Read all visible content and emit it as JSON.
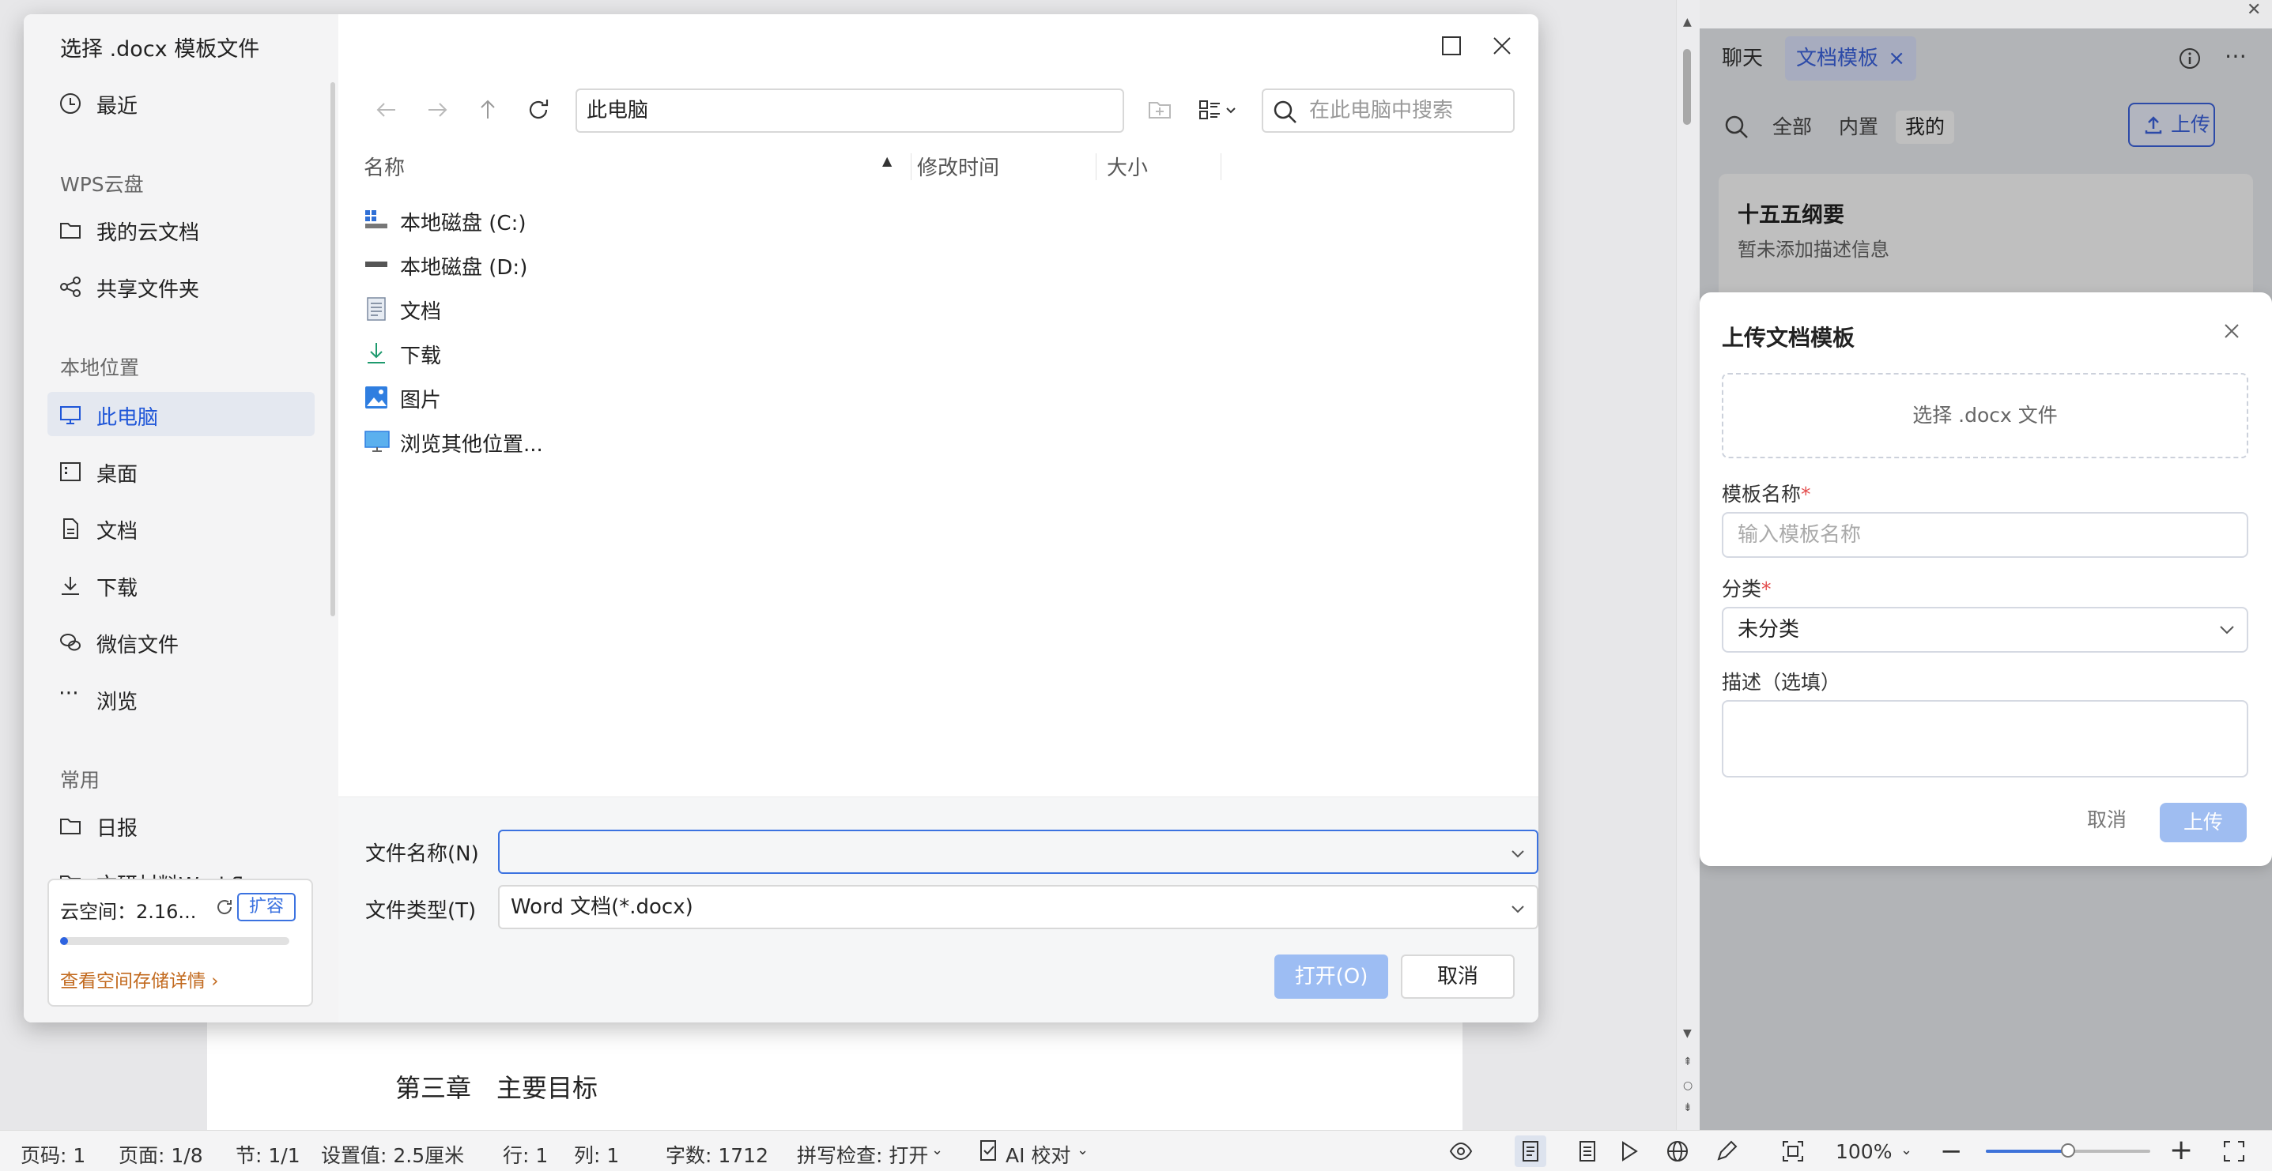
{
  "document": {
    "heading": "第三章　主要目标"
  },
  "file_dialog": {
    "title": "选择 .docx 模板文件",
    "sidebar": {
      "recent": "最近",
      "wps_cloud_section": "WPS云盘",
      "cloud_items": [
        "我的云文档",
        "共享文件夹"
      ],
      "local_section": "本地位置",
      "local_items": [
        "此电脑",
        "桌面",
        "文档",
        "下载",
        "微信文件",
        "浏览"
      ],
      "common_section": "常用",
      "common_items": [
        "日报",
        "文研材料Workflo"
      ]
    },
    "cloud": {
      "label": "云空间：2.16...",
      "expand": "扩容",
      "link": "查看空间存储详情",
      "usage_fraction": 0.03
    },
    "address": "此电脑",
    "search_placeholder": "在此电脑中搜索",
    "columns": {
      "name": "名称",
      "modified": "修改时间",
      "size": "大小"
    },
    "files": [
      "本地磁盘 (C:)",
      "本地磁盘 (D:)",
      "文档",
      "下载",
      "图片",
      "浏览其他位置..."
    ],
    "filename_label": "文件名称(N)",
    "filename_value": "",
    "filetype_label": "文件类型(T)",
    "filetype_value": "Word 文档(*.docx)",
    "open_button": "打开(O)",
    "cancel_button": "取消"
  },
  "right_panel": {
    "tabs": [
      "聊天",
      "文档模板"
    ],
    "tab_close": "×",
    "filters": [
      "全部",
      "内置",
      "我的"
    ],
    "upload_button": "上传",
    "card": {
      "title": "十五五纲要",
      "description": "暂未添加描述信息"
    }
  },
  "upload_modal": {
    "title": "上传文档模板",
    "drop_text": "选择 .docx 文件",
    "name_label": "模板名称",
    "name_placeholder": "输入模板名称",
    "category_label": "分类",
    "category_value": "未分类",
    "desc_label": "描述（选填）",
    "required_mark": "*",
    "cancel": "取消",
    "submit": "上传"
  },
  "statusbar": {
    "page_number": "页码: 1",
    "pages": "页面: 1/8",
    "section": "节: 1/1",
    "setting": "设置值: 2.5厘米",
    "row": "行: 1",
    "column": "列: 1",
    "word_count": "字数: 1712",
    "spell_check": "拼写检查: 打开",
    "ai_proof": "AI 校对",
    "zoom": "100%",
    "zoom_fraction": 0.5
  },
  "colors": {
    "accent": "#3b63e0",
    "open_disabled": "#9dbdf3",
    "link": "#c26a1f"
  }
}
